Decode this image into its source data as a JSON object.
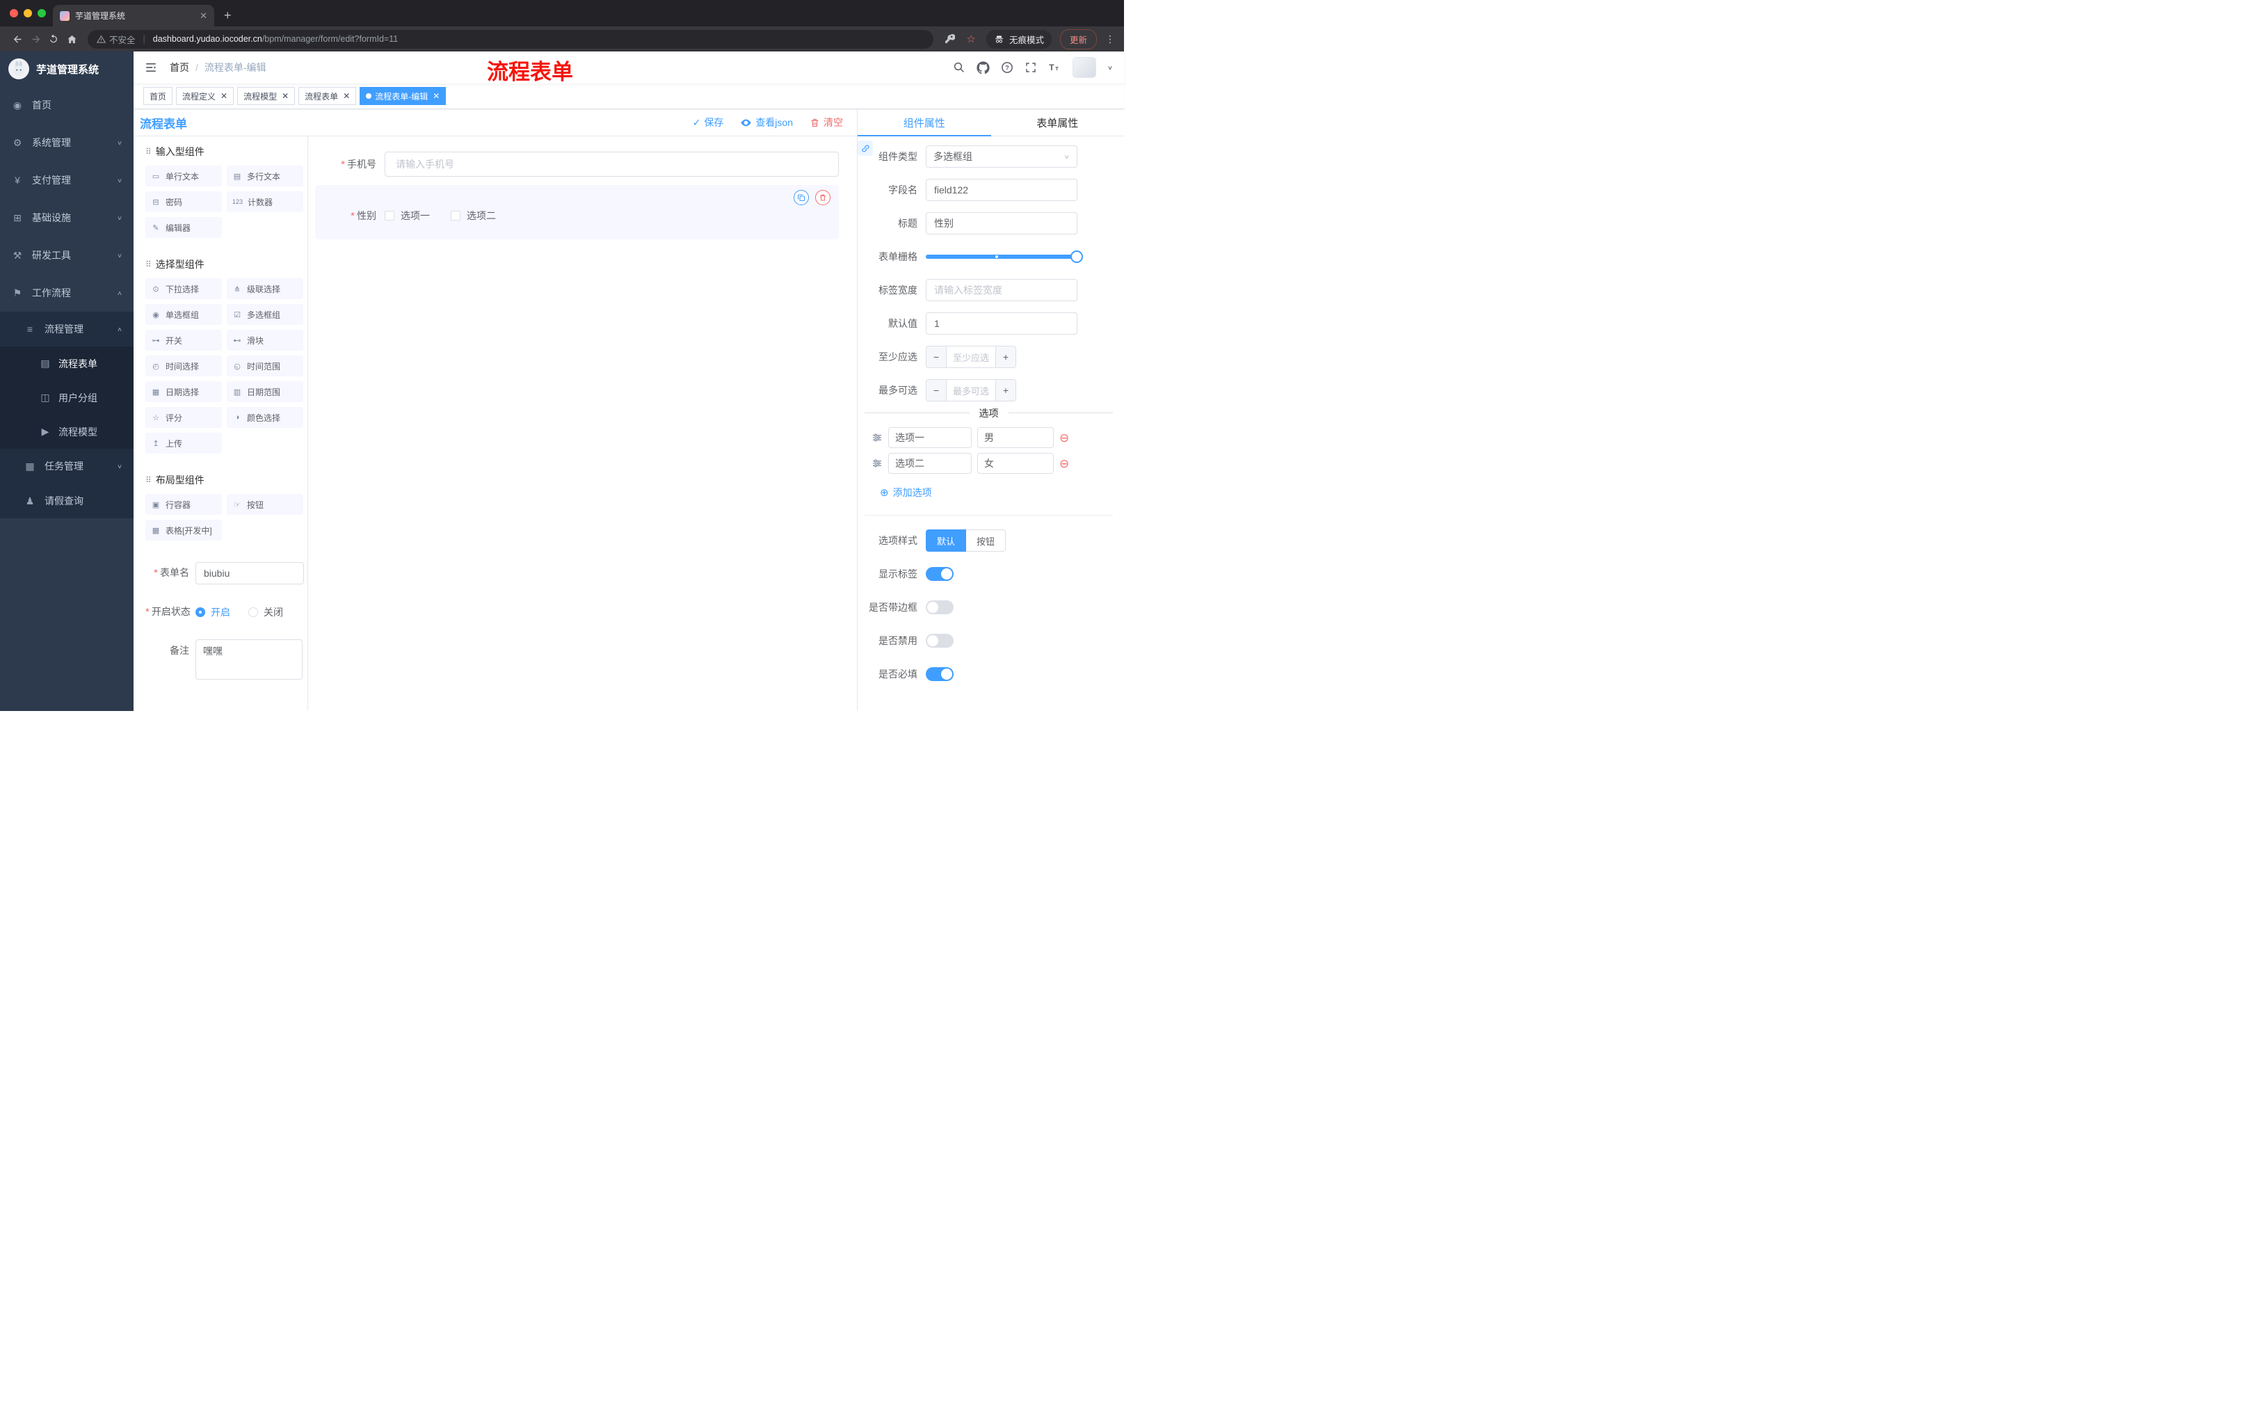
{
  "colors": {
    "accent": "#409eff",
    "danger": "#f56c6c",
    "annotation_red": "#f5150a"
  },
  "browser": {
    "tab_title": "芋道管理系统",
    "security_label": "不安全",
    "url_domain": "dashboard.yudao.iocoder.cn",
    "url_path": "/bpm/manager/form/edit?formId=11",
    "incognito_label": "无痕模式",
    "update_label": "更新"
  },
  "annotation": "流程表单",
  "sidebar": {
    "logo_title": "芋道管理系统",
    "menu": [
      {
        "label": "首页",
        "glyph": "◉"
      },
      {
        "label": "系统管理",
        "glyph": "⚙"
      },
      {
        "label": "支付管理",
        "glyph": "¥"
      },
      {
        "label": "基础设施",
        "glyph": "⊞"
      },
      {
        "label": "研发工具",
        "glyph": "⚒"
      },
      {
        "label": "工作流程",
        "glyph": "⚑"
      },
      {
        "label": "流程管理",
        "glyph": "≡"
      },
      {
        "label": "流程表单",
        "glyph": "▤"
      },
      {
        "label": "用户分组",
        "glyph": "◫"
      },
      {
        "label": "流程模型",
        "glyph": "▶"
      },
      {
        "label": "任务管理",
        "glyph": "▦"
      },
      {
        "label": "请假查询",
        "glyph": "♟"
      }
    ]
  },
  "navbar": {
    "breadcrumb_home": "首页",
    "breadcrumb_current": "流程表单-编辑"
  },
  "tags": [
    {
      "label": "首页"
    },
    {
      "label": "流程定义"
    },
    {
      "label": "流程模型"
    },
    {
      "label": "流程表单"
    },
    {
      "label": "流程表单-编辑"
    }
  ],
  "designer": {
    "title": "流程表单",
    "toolbar": {
      "save": "保存",
      "view_json": "查看json",
      "clear": "清空"
    },
    "palette": {
      "sections": [
        {
          "title": "输入型组件",
          "items": [
            {
              "label": "单行文本",
              "glyph": "▭"
            },
            {
              "label": "多行文本",
              "glyph": "▤"
            },
            {
              "label": "密码",
              "glyph": "⊟"
            },
            {
              "label": "计数器",
              "glyph": "123"
            },
            {
              "label": "编辑器",
              "glyph": "✎"
            }
          ]
        },
        {
          "title": "选择型组件",
          "items": [
            {
              "label": "下拉选择",
              "glyph": "⊙"
            },
            {
              "label": "级联选择",
              "glyph": "⋔"
            },
            {
              "label": "单选框组",
              "glyph": "◉"
            },
            {
              "label": "多选框组",
              "glyph": "☑"
            },
            {
              "label": "开关",
              "glyph": "⊶"
            },
            {
              "label": "滑块",
              "glyph": "⊷"
            },
            {
              "label": "时间选择",
              "glyph": "◴"
            },
            {
              "label": "时间范围",
              "glyph": "◵"
            },
            {
              "label": "日期选择",
              "glyph": "▦"
            },
            {
              "label": "日期范围",
              "glyph": "▥"
            },
            {
              "label": "评分",
              "glyph": "☆"
            },
            {
              "label": "颜色选择",
              "glyph": "◑"
            },
            {
              "label": "上传",
              "glyph": "↥"
            }
          ]
        },
        {
          "title": "布局型组件",
          "items": [
            {
              "label": "行容器",
              "glyph": "▣"
            },
            {
              "label": "按钮",
              "glyph": "☞"
            },
            {
              "label": "表格[开发中]",
              "glyph": "▦"
            }
          ]
        }
      ],
      "form": {
        "name_label": "表单名",
        "name_value": "biubiu",
        "status_label": "开启状态",
        "status_on": "开启",
        "status_off": "关闭",
        "remark_label": "备注",
        "remark_value": "嘿嘿"
      }
    },
    "canvas": {
      "phone_label": "手机号",
      "phone_placeholder": "请输入手机号",
      "gender_label": "性别",
      "gender_options": [
        "选项一",
        "选项二"
      ]
    },
    "props": {
      "tab_component": "组件属性",
      "tab_form": "表单属性",
      "component_type_label": "组件类型",
      "component_type_value": "多选框组",
      "field_name_label": "字段名",
      "field_name_value": "field122",
      "title_label": "标题",
      "title_value": "性别",
      "grid_label": "表单栅格",
      "label_width_label": "标签宽度",
      "label_width_placeholder": "请输入标签宽度",
      "default_label": "默认值",
      "default_value": "1",
      "min_label": "至少应选",
      "min_placeholder": "至少应选",
      "max_label": "最多可选",
      "max_placeholder": "最多可选",
      "options_title": "选项",
      "options": [
        {
          "label": "选项一",
          "value": "男"
        },
        {
          "label": "选项二",
          "value": "女"
        }
      ],
      "add_option": "添加选项",
      "style_label": "选项样式",
      "style_default": "默认",
      "style_button": "按钮",
      "switch_show_label": "显示标签",
      "switch_border": "是否带边框",
      "switch_disabled": "是否禁用",
      "switch_required": "是否必填"
    }
  }
}
